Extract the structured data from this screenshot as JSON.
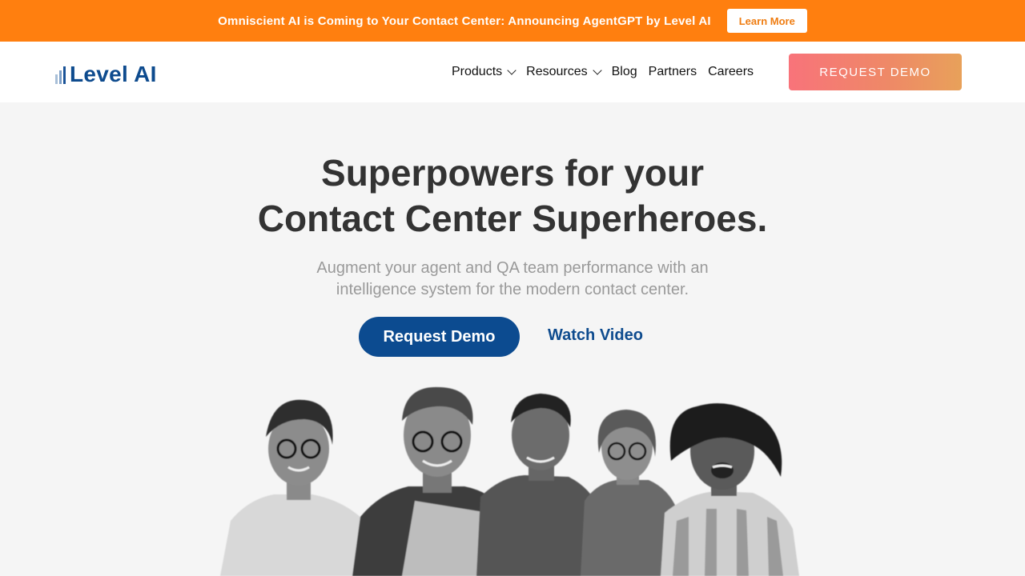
{
  "announcement": {
    "text": "Omniscient AI is Coming to Your Contact Center: Announcing AgentGPT by Level AI",
    "button": "Learn More"
  },
  "header": {
    "logo": "Level AI",
    "nav": [
      {
        "label": "Products",
        "dropdown": true
      },
      {
        "label": "Resources",
        "dropdown": true
      },
      {
        "label": "Blog",
        "dropdown": false
      },
      {
        "label": "Partners",
        "dropdown": false
      },
      {
        "label": "Careers",
        "dropdown": false
      }
    ],
    "cta": "REQUEST DEMO"
  },
  "hero": {
    "title_line1": "Superpowers for your",
    "title_line2": "Contact Center Superheroes.",
    "subtitle_line1": "Augment your agent and QA team performance with an",
    "subtitle_line2": "intelligence system for the modern contact center.",
    "primary_cta": "Request Demo",
    "secondary_cta": "Watch Video"
  },
  "colors": {
    "banner": "#ff7f0f",
    "brand_blue": "#0c4b90",
    "gradient_start": "#f8737a",
    "gradient_end": "#e8a15a"
  }
}
